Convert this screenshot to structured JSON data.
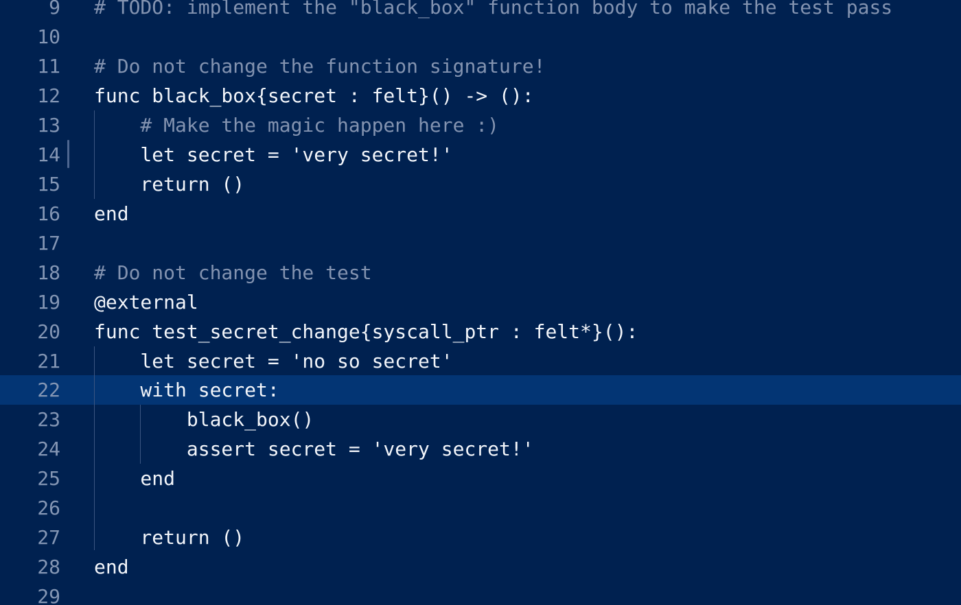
{
  "theme": {
    "background": "#002150",
    "active_line_background": "#033574",
    "line_number_color": "#8496b4",
    "comment_color": "#8393b0",
    "code_color": "#f2f5fa"
  },
  "editor": {
    "active_line": 22,
    "lines": [
      {
        "number": "9",
        "text": "# TODO: implement the \"black_box\" function body to make the test pass",
        "kind": "comment"
      },
      {
        "number": "10",
        "text": "",
        "kind": "code"
      },
      {
        "number": "11",
        "text": "# Do not change the function signature!",
        "kind": "comment"
      },
      {
        "number": "12",
        "text": "func black_box{secret : felt}() -> ():",
        "kind": "code"
      },
      {
        "number": "13",
        "text": "    # Make the magic happen here :)",
        "kind": "comment"
      },
      {
        "number": "14",
        "text": "    let secret = 'very secret!'",
        "kind": "code"
      },
      {
        "number": "15",
        "text": "    return ()",
        "kind": "code"
      },
      {
        "number": "16",
        "text": "end",
        "kind": "code"
      },
      {
        "number": "17",
        "text": "",
        "kind": "code"
      },
      {
        "number": "18",
        "text": "# Do not change the test",
        "kind": "comment"
      },
      {
        "number": "19",
        "text": "@external",
        "kind": "code"
      },
      {
        "number": "20",
        "text": "func test_secret_change{syscall_ptr : felt*}():",
        "kind": "code"
      },
      {
        "number": "21",
        "text": "    let secret = 'no so secret'",
        "kind": "code"
      },
      {
        "number": "22",
        "text": "    with secret:",
        "kind": "code"
      },
      {
        "number": "23",
        "text": "        black_box()",
        "kind": "code"
      },
      {
        "number": "24",
        "text": "        assert secret = 'very secret!'",
        "kind": "code"
      },
      {
        "number": "25",
        "text": "    end",
        "kind": "code"
      },
      {
        "number": "26",
        "text": "",
        "kind": "code"
      },
      {
        "number": "27",
        "text": "    return ()",
        "kind": "code"
      },
      {
        "number": "28",
        "text": "end",
        "kind": "code"
      },
      {
        "number": "29",
        "text": "",
        "kind": "code"
      }
    ]
  }
}
